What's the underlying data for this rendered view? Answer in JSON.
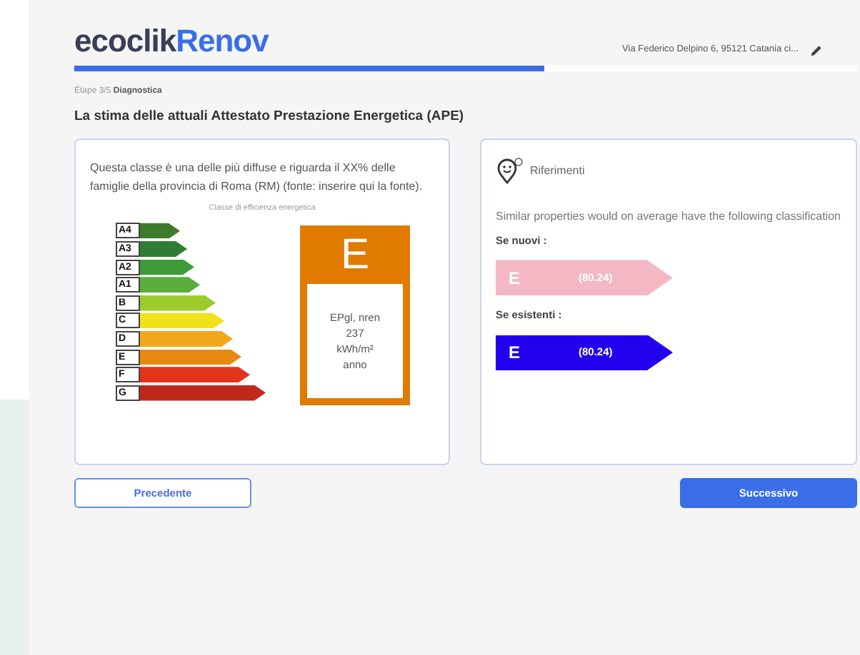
{
  "header": {
    "logo": {
      "part_1": "ecoclik",
      "part_2": "Renov"
    },
    "address": "Via Federico Delpino 6, 95121 Catania ci..."
  },
  "progress": {
    "level": 0.6
  },
  "step": {
    "counter": "Étape 3/5",
    "name": "Diagnostica"
  },
  "title": "La stima delle attuali Attestato Prestazione Energetica (APE)",
  "class_card": {
    "text": "Questa classe è una delle più diffuse e riguarda il XX% delle famiglie della provincia di Roma (RM) (fonte: inserire qui la fonte).",
    "scale_title": "Classe di efficienza energetica",
    "classes": [
      {
        "label": "A4",
        "color": "#3d7a2a"
      },
      {
        "label": "A3",
        "color": "#2e7d32"
      },
      {
        "label": "A2",
        "color": "#3f9a3a"
      },
      {
        "label": "A1",
        "color": "#5aae3c"
      },
      {
        "label": "B",
        "color": "#9ccb2e"
      },
      {
        "label": "C",
        "color": "#f2e21a"
      },
      {
        "label": "D",
        "color": "#f0a81c"
      },
      {
        "label": "E",
        "color": "#e88a12"
      },
      {
        "label": "F",
        "color": "#e2341a"
      },
      {
        "label": "G",
        "color": "#c0281c"
      }
    ],
    "current": {
      "grade": "E",
      "color": "#e07b00",
      "lines": [
        "EPgl, nren",
        "237",
        "kWh/m²",
        "anno"
      ]
    }
  },
  "references": {
    "title": "Riferimenti",
    "text": "Similar properties would on average have the following classification",
    "groups": [
      {
        "label": "Se nuovi :",
        "grade": "E",
        "value": "(80.24)",
        "color": "#f4b8c4"
      },
      {
        "label": "Se esistenti :",
        "grade": "E",
        "value": "(80.24)",
        "color": "#2200ee"
      }
    ]
  },
  "buttons": [
    {
      "label": "Precedente",
      "kind": "outline"
    },
    {
      "label": "Successivo",
      "kind": "primary"
    }
  ]
}
